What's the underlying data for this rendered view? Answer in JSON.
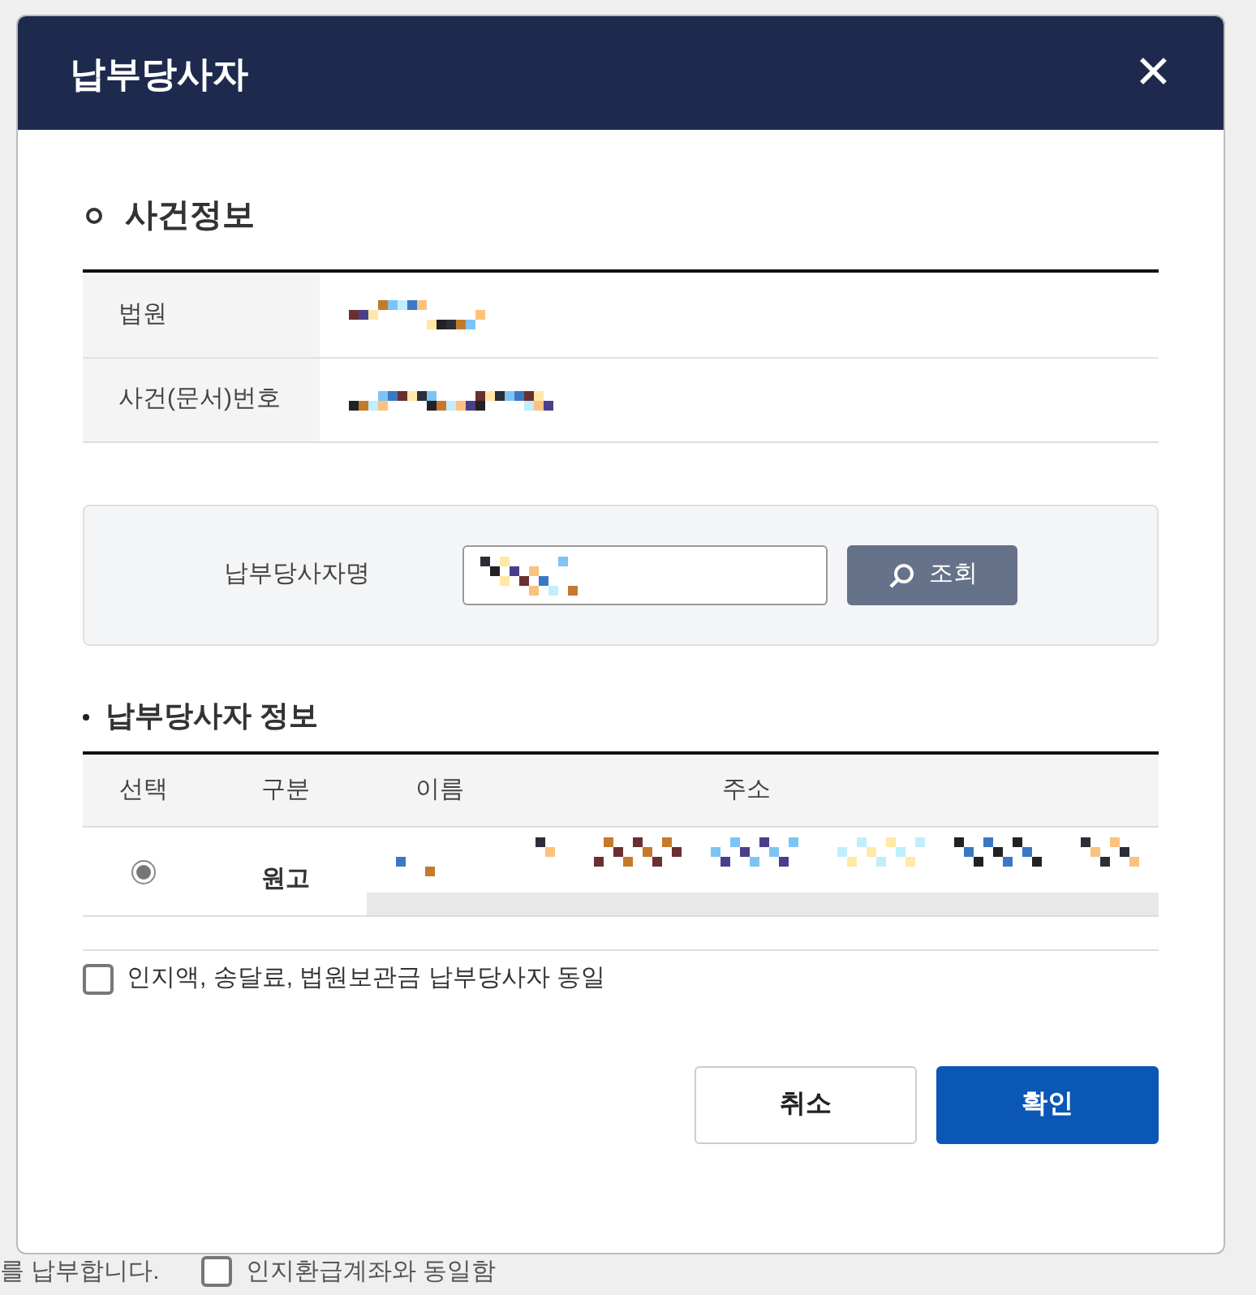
{
  "background": {
    "footer_text": "를 납부합니다.",
    "footer_checkbox": {
      "label": "인지환급계좌와 동일함",
      "checked": false
    }
  },
  "dialog": {
    "title": "납부당사자",
    "close": "✕",
    "case_info": {
      "heading": "사건정보",
      "rows": [
        {
          "label": "법원"
        },
        {
          "label": "사건(문서)번호"
        }
      ]
    },
    "search": {
      "label": "납부당사자명",
      "button": "조회"
    },
    "party_info": {
      "heading": "납부당사자 정보",
      "columns": [
        "선택",
        "구분",
        "이름",
        "주소"
      ],
      "rows": [
        {
          "selected": true,
          "type": "원고"
        }
      ]
    },
    "same_party": {
      "label": "인지액, 송달료, 법원보관금 납부당사자 동일",
      "checked": false
    },
    "buttons": [
      {
        "label": "취소",
        "kind": "secondary"
      },
      {
        "label": "확인",
        "kind": "primary"
      }
    ]
  }
}
